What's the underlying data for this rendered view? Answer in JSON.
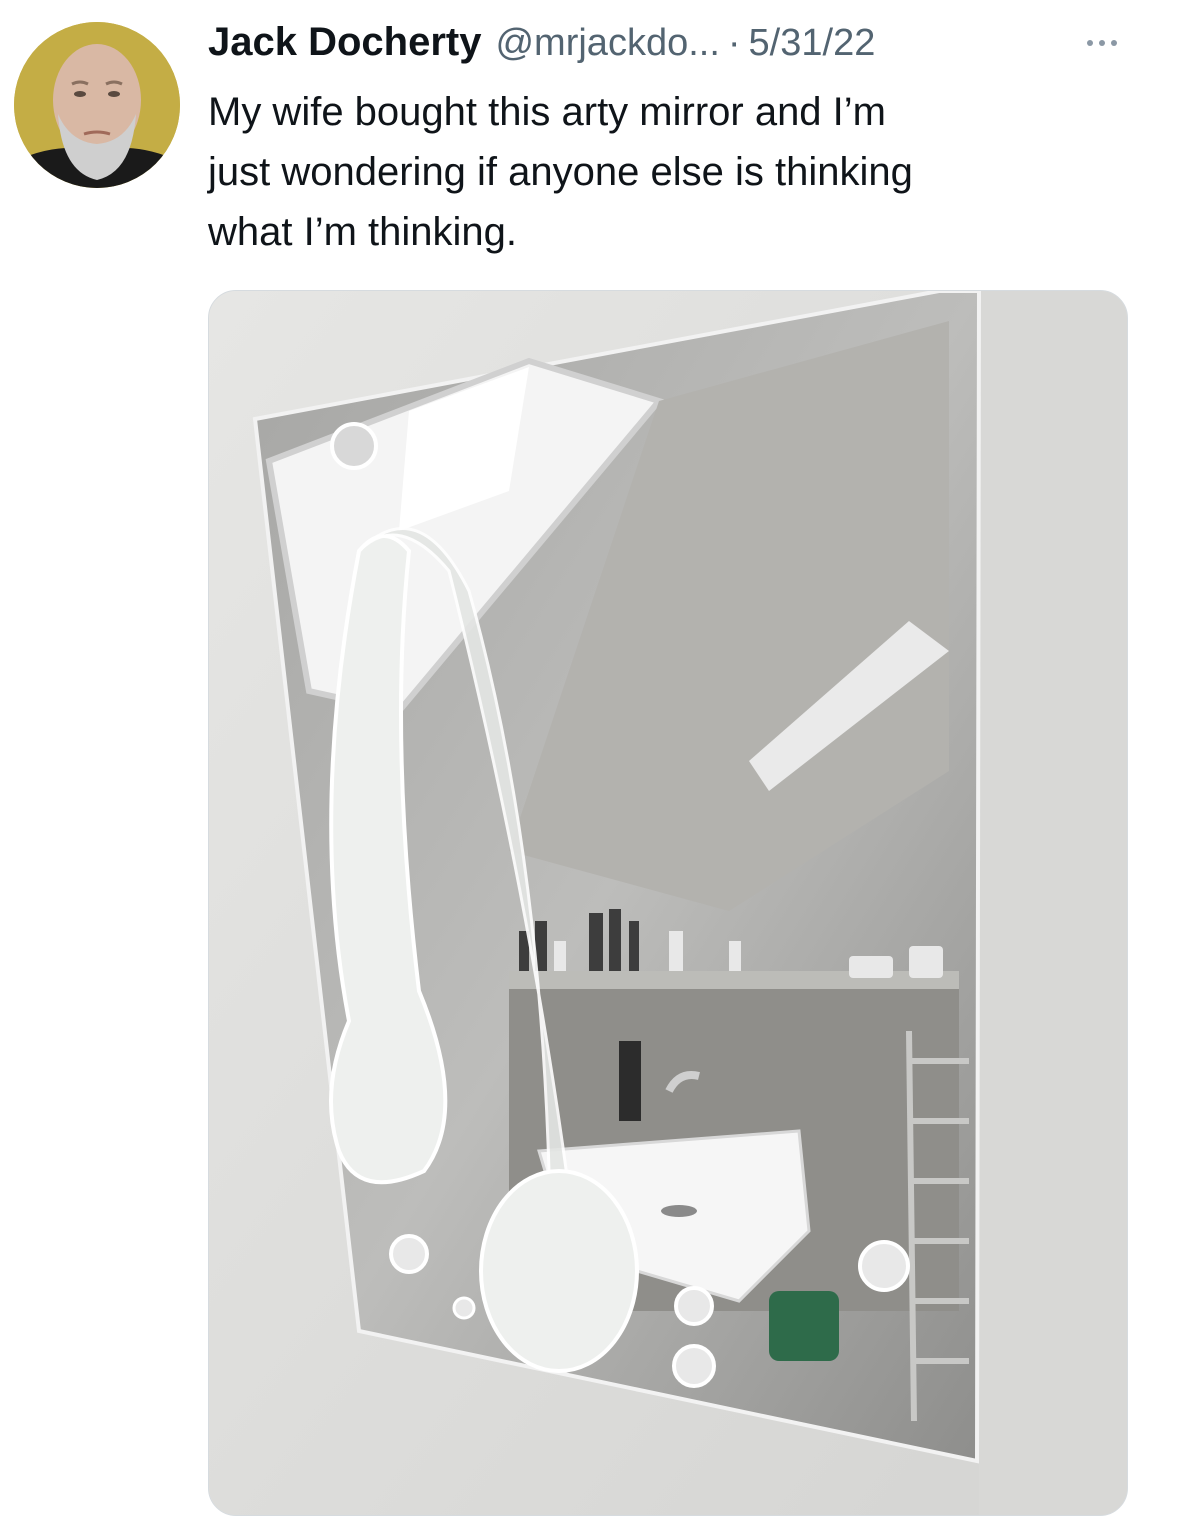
{
  "tweet": {
    "author_name": "Jack Docherty",
    "handle": "@mrjackdo...",
    "separator": "·",
    "date": "5/31/22",
    "more_icon": "more-horizontal-icon",
    "text_lines": [
      "My wife bought this arty mirror and I’m",
      "just wondering if anyone else is thinking",
      "what I’m thinking."
    ]
  }
}
